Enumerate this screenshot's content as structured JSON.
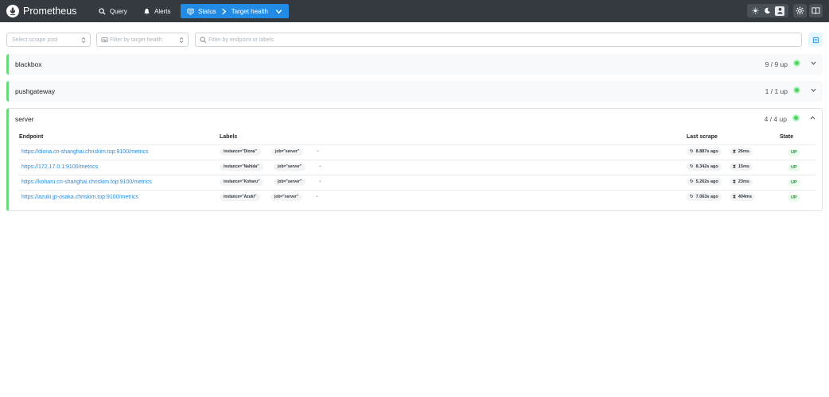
{
  "header": {
    "brand": "Prometheus",
    "nav": {
      "query": "Query",
      "alerts": "Alerts",
      "status": "Status",
      "status_page": "Target health"
    }
  },
  "filters": {
    "scrape_pool_placeholder": "Select scrape pool",
    "health_placeholder": "Filter by target health",
    "search_placeholder": "Filter by endpoint or labels"
  },
  "pools": [
    {
      "name": "blackbox",
      "count": "9 / 9 up"
    },
    {
      "name": "pushgateway",
      "count": "1 / 1 up"
    },
    {
      "name": "server",
      "count": "4 / 4 up"
    }
  ],
  "table": {
    "columns": {
      "endpoint": "Endpoint",
      "labels": "Labels",
      "last_scrape": "Last scrape",
      "state": "State"
    },
    "rows": [
      {
        "endpoint": "https://diona.cn-shanghai.chriskim.top:9100/metrics",
        "instance": "instance=\"Diona\"",
        "job": "job=\"server\"",
        "last": "8.887s ago",
        "duration": "26ms",
        "state": "UP"
      },
      {
        "endpoint": "https://172.17.0.1:9100/metrics",
        "instance": "instance=\"Nahida\"",
        "job": "job=\"server\"",
        "last": "8.342s ago",
        "duration": "15ms",
        "state": "UP"
      },
      {
        "endpoint": "https://koharu.cn-shanghai.chriskim.top:9100/metrics",
        "instance": "instance=\"Koharu\"",
        "job": "job=\"server\"",
        "last": "5.262s ago",
        "duration": "23ms",
        "state": "UP"
      },
      {
        "endpoint": "https://azuki.jp-osaka.chriskim.top:9100/metrics",
        "instance": "instance=\"Azuki\"",
        "job": "job=\"server\"",
        "last": "7.063s ago",
        "duration": "404ms",
        "state": "UP"
      }
    ]
  }
}
